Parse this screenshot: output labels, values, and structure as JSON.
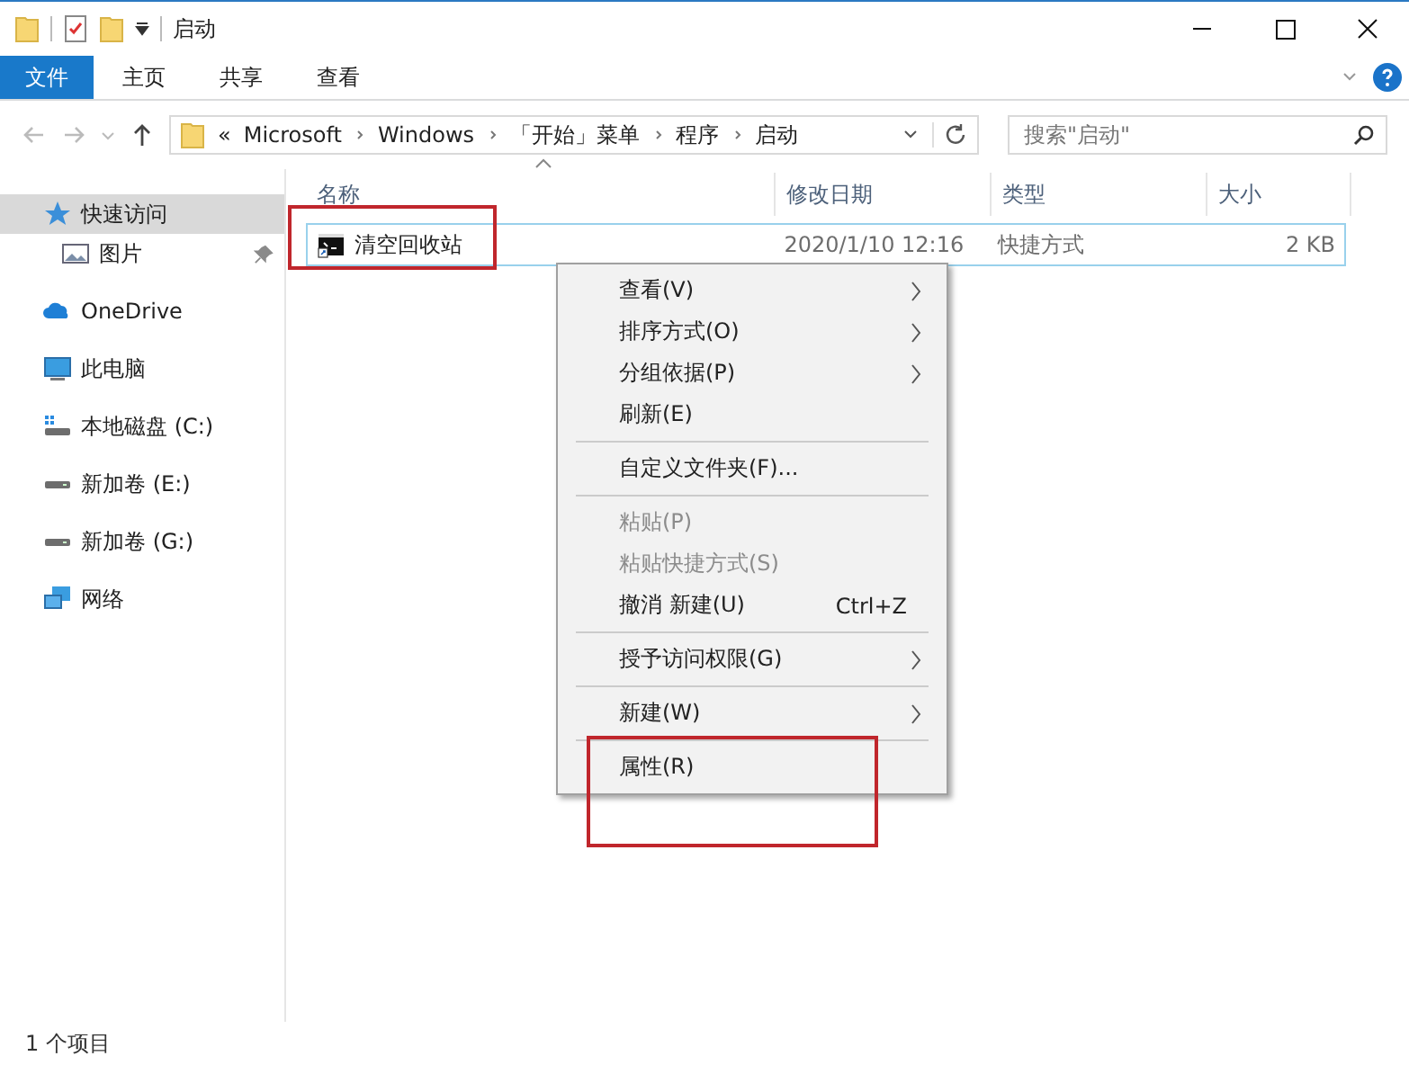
{
  "window": {
    "title": "启动"
  },
  "ribbon_tabs": [
    {
      "label": "文件",
      "selected": true
    },
    {
      "label": "主页",
      "selected": false
    },
    {
      "label": "共享",
      "selected": false
    },
    {
      "label": "查看",
      "selected": false
    }
  ],
  "address": {
    "overflow": "«",
    "crumbs": [
      "Microsoft",
      "Windows",
      "「开始」菜单",
      "程序",
      "启动"
    ]
  },
  "search": {
    "placeholder": "搜索\"启动\""
  },
  "sidebar": {
    "items": [
      {
        "label": "快速访问",
        "selected": true,
        "children": [
          {
            "label": "图片",
            "selected": false,
            "pinned": true
          }
        ]
      },
      {
        "label": "OneDrive",
        "selected": false
      },
      {
        "label": "此电脑",
        "selected": false
      },
      {
        "label": "本地磁盘 (C:)",
        "selected": false
      },
      {
        "label": "新加卷 (E:)",
        "selected": false
      },
      {
        "label": "新加卷 (G:)",
        "selected": false
      },
      {
        "label": "网络",
        "selected": false
      }
    ]
  },
  "table": {
    "columns": [
      "名称",
      "修改日期",
      "类型",
      "大小"
    ],
    "rows": [
      {
        "name": "清空回收站",
        "modified": "2020/1/10 12:16",
        "type": "快捷方式",
        "size": "2 KB",
        "selected": true,
        "highlighted": true
      }
    ]
  },
  "context_menu": [
    {
      "kind": "item",
      "label": "查看(V)",
      "submenu": true,
      "disabled": false,
      "highlighted": false
    },
    {
      "kind": "item",
      "label": "排序方式(O)",
      "submenu": true,
      "disabled": false,
      "highlighted": false
    },
    {
      "kind": "item",
      "label": "分组依据(P)",
      "submenu": true,
      "disabled": false,
      "highlighted": false
    },
    {
      "kind": "item",
      "label": "刷新(E)",
      "submenu": false,
      "disabled": false,
      "highlighted": false
    },
    {
      "kind": "separator"
    },
    {
      "kind": "item",
      "label": "自定义文件夹(F)...",
      "submenu": false,
      "disabled": false,
      "highlighted": false
    },
    {
      "kind": "separator"
    },
    {
      "kind": "item",
      "label": "粘贴(P)",
      "submenu": false,
      "disabled": true,
      "highlighted": false
    },
    {
      "kind": "item",
      "label": "粘贴快捷方式(S)",
      "submenu": false,
      "disabled": true,
      "highlighted": false
    },
    {
      "kind": "item",
      "label": "撤消 新建(U)",
      "shortcut": "Ctrl+Z",
      "submenu": false,
      "disabled": false,
      "highlighted": false
    },
    {
      "kind": "separator"
    },
    {
      "kind": "item",
      "label": "授予访问权限(G)",
      "submenu": true,
      "disabled": false,
      "highlighted": false
    },
    {
      "kind": "separator"
    },
    {
      "kind": "item",
      "label": "新建(W)",
      "submenu": true,
      "disabled": false,
      "highlighted": false
    },
    {
      "kind": "separator"
    },
    {
      "kind": "item",
      "label": "属性(R)",
      "submenu": false,
      "disabled": false,
      "highlighted": true
    }
  ],
  "status_bar": {
    "text": "1 个项目"
  }
}
